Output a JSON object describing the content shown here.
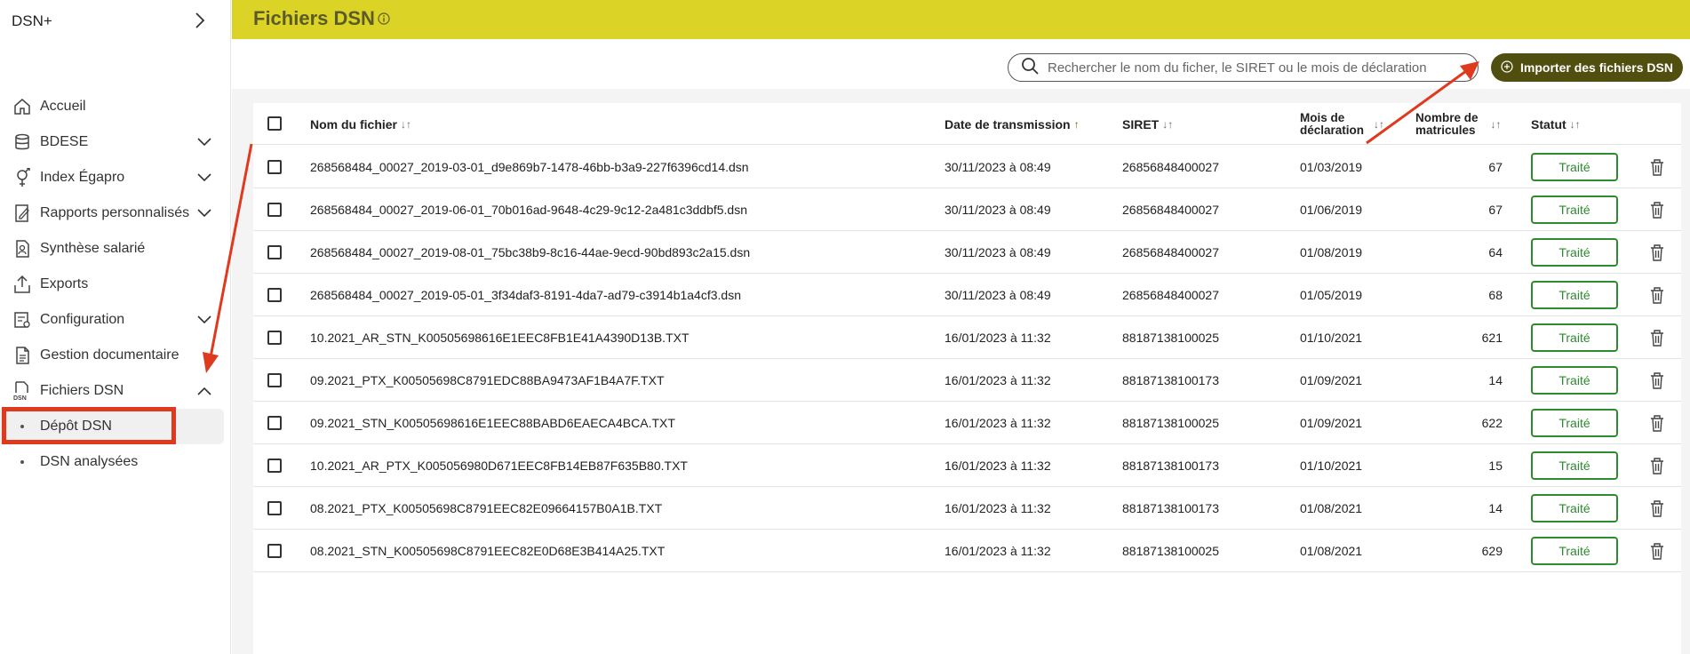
{
  "app": {
    "brand": "DSN+"
  },
  "sidebar": {
    "items": [
      {
        "label": "Accueil",
        "icon": "home-icon",
        "expandable": false
      },
      {
        "label": "BDESE",
        "icon": "database-icon",
        "expandable": true
      },
      {
        "label": "Index Égapro",
        "icon": "gender-icon",
        "expandable": true
      },
      {
        "label": "Rapports personnalisés",
        "icon": "report-edit-icon",
        "expandable": true
      },
      {
        "label": "Synthèse salarié",
        "icon": "employee-file-icon",
        "expandable": false
      },
      {
        "label": "Exports",
        "icon": "upload-icon",
        "expandable": false
      },
      {
        "label": "Configuration",
        "icon": "config-icon",
        "expandable": true
      },
      {
        "label": "Gestion documentaire",
        "icon": "document-icon",
        "expandable": false
      },
      {
        "label": "Fichiers DSN",
        "icon": "dsn-file-icon",
        "icon_text": "DSN",
        "expandable": true,
        "expanded": true
      }
    ],
    "subitems": [
      {
        "label": "Dépôt DSN",
        "active": true
      },
      {
        "label": "DSN analysées",
        "active": false
      }
    ]
  },
  "header": {
    "title": "Fichiers DSN"
  },
  "search": {
    "placeholder": "Rechercher le nom du ficher, le SIRET ou le mois de déclaration"
  },
  "toolbar": {
    "import_label": "Importer des fichiers DSN"
  },
  "table": {
    "columns": {
      "name": "Nom du fichier",
      "date": "Date de transmission",
      "siret": "SIRET",
      "month_line1": "Mois de",
      "month_line2": "déclaration",
      "count_line1": "Nombre de",
      "count_line2": "matricules",
      "status": "Statut"
    },
    "rows": [
      {
        "name": "268568484_00027_2019-03-01_d9e869b7-1478-46bb-b3a9-227f6396cd14.dsn",
        "date": "30/11/2023 à 08:49",
        "siret": "26856848400027",
        "month": "01/03/2019",
        "count": "67",
        "status": "Traité"
      },
      {
        "name": "268568484_00027_2019-06-01_70b016ad-9648-4c29-9c12-2a481c3ddbf5.dsn",
        "date": "30/11/2023 à 08:49",
        "siret": "26856848400027",
        "month": "01/06/2019",
        "count": "67",
        "status": "Traité"
      },
      {
        "name": "268568484_00027_2019-08-01_75bc38b9-8c16-44ae-9ecd-90bd893c2a15.dsn",
        "date": "30/11/2023 à 08:49",
        "siret": "26856848400027",
        "month": "01/08/2019",
        "count": "64",
        "status": "Traité"
      },
      {
        "name": "268568484_00027_2019-05-01_3f34daf3-8191-4da7-ad79-c3914b1a4cf3.dsn",
        "date": "30/11/2023 à 08:49",
        "siret": "26856848400027",
        "month": "01/05/2019",
        "count": "68",
        "status": "Traité"
      },
      {
        "name": "10.2021_AR_STN_K00505698616E1EEC8FB1E41A4390D13B.TXT",
        "date": "16/01/2023 à 11:32",
        "siret": "88187138100025",
        "month": "01/10/2021",
        "count": "621",
        "status": "Traité"
      },
      {
        "name": "09.2021_PTX_K00505698C8791EDC88BA9473AF1B4A7F.TXT",
        "date": "16/01/2023 à 11:32",
        "siret": "88187138100173",
        "month": "01/09/2021",
        "count": "14",
        "status": "Traité"
      },
      {
        "name": "09.2021_STN_K00505698616E1EEC88BABD6EAECA4BCA.TXT",
        "date": "16/01/2023 à 11:32",
        "siret": "88187138100025",
        "month": "01/09/2021",
        "count": "622",
        "status": "Traité"
      },
      {
        "name": "10.2021_AR_PTX_K005056980D671EEC8FB14EB87F635B80.TXT",
        "date": "16/01/2023 à 11:32",
        "siret": "88187138100173",
        "month": "01/10/2021",
        "count": "15",
        "status": "Traité"
      },
      {
        "name": "08.2021_PTX_K00505698C8791EEC82E09664157B0A1B.TXT",
        "date": "16/01/2023 à 11:32",
        "siret": "88187138100173",
        "month": "01/08/2021",
        "count": "14",
        "status": "Traité"
      },
      {
        "name": "08.2021_STN_K00505698C8791EEC82E0D68E3B414A25.TXT",
        "date": "16/01/2023 à 11:32",
        "siret": "88187138100025",
        "month": "01/08/2021",
        "count": "629",
        "status": "Traité"
      }
    ]
  },
  "colors": {
    "header_bg": "#dbd326",
    "accent_dark": "#514f10",
    "status_green": "#2e8b2e",
    "annotation_red": "#e03a1e"
  }
}
